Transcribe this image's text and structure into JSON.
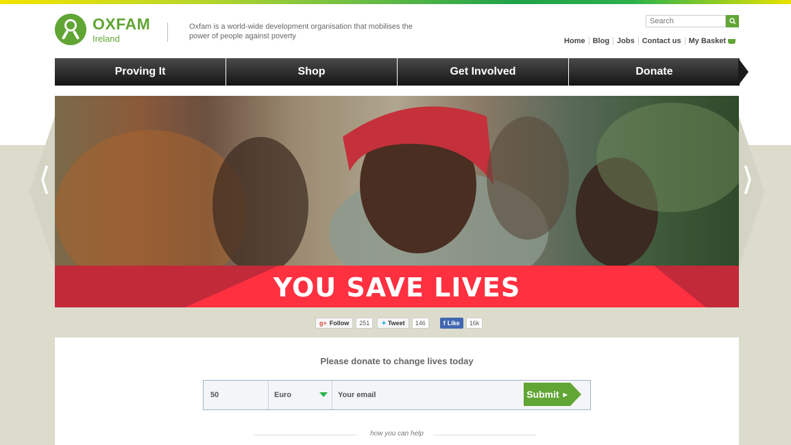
{
  "brand": {
    "name": "OXFAM",
    "sub": "Ireland",
    "color": "#61a534"
  },
  "tagline": "Oxfam is a world-wide development organisation that mobilises the power of people against poverty",
  "search": {
    "placeholder": "Search"
  },
  "toplinks": [
    "Home",
    "Blog",
    "Jobs",
    "Contact us",
    "My Basket"
  ],
  "nav": [
    "Proving It",
    "Shop",
    "Get Involved",
    "Donate"
  ],
  "hero": {
    "banner_text": "YOU SAVE LIVES"
  },
  "social": {
    "google": {
      "label": "Follow",
      "count": "251"
    },
    "twitter": {
      "label": "Tweet",
      "count": "146"
    },
    "facebook": {
      "label": "Like",
      "count": "16k"
    }
  },
  "donate": {
    "title": "Please donate to change lives today",
    "amount": "50",
    "currency": "Euro",
    "email_placeholder": "Your email",
    "submit": "Submit"
  },
  "howto": "how you can help"
}
